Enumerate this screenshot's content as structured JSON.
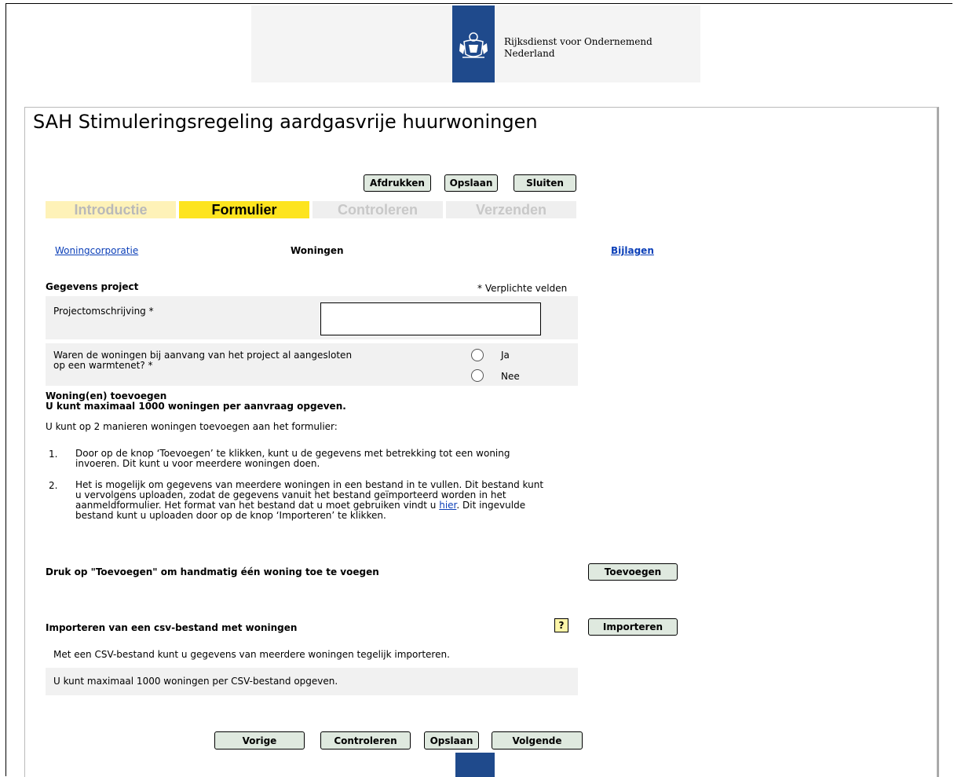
{
  "header": {
    "org_line1": "Rijksdienst voor Ondernemend",
    "org_line2": "Nederland"
  },
  "page_title": "SAH Stimuleringsregeling aardgasvrije huurwoningen",
  "top_buttons": {
    "print": "Afdrukken",
    "save": "Opslaan",
    "close": "Sluiten"
  },
  "steps": {
    "intro": "Introductie",
    "form": "Formulier",
    "check": "Controleren",
    "send": "Verzenden"
  },
  "subnav": {
    "corporation": "Woningcorporatie",
    "homes": "Woningen",
    "attachments": "Bijlagen"
  },
  "project": {
    "heading": "Gegevens project",
    "required_note": "* Verplichte velden",
    "description_label": "Projectomschrijving *",
    "description_value": "",
    "heat_q_line1": "Waren de woningen bij aanvang van het project al aangesloten",
    "heat_q_line2": "op een warmtenet? *",
    "opt_yes": "Ja",
    "opt_no": "Nee"
  },
  "add": {
    "heading": "Woning(en) toevoegen",
    "max_note": "U kunt maximaal 1000 woningen per aanvraag opgeven.",
    "intro": "U kunt op 2 manieren woningen toevoegen aan het formulier:",
    "item1_num": "1.",
    "item1_l1": "Door op de knop ‘Toevoegen’ te klikken, kunt u de gegevens met betrekking tot een woning",
    "item1_l2": "invoeren. Dit kunt u voor meerdere woningen doen.",
    "item2_num": "2.",
    "item2_l1": "Het is mogelijk om gegevens van meerdere woningen in een bestand in te vullen. Dit bestand kunt",
    "item2_l2": "u vervolgens uploaden, zodat de gegevens vanuit het bestand geïmporteerd worden in het",
    "item2_l3": "aanmeldformulier. Het format van het bestand dat u moet gebruiken vindt u",
    "item2_link": "hier",
    "item2_l3_end": ". Dit ingevulde",
    "item2_l4": "bestand kunt u uploaden door op de knop ‘Importeren’ te klikken."
  },
  "manual": {
    "label": "Druk op \"Toevoegen\" om handmatig één woning toe te voegen",
    "button": "Toevoegen"
  },
  "import": {
    "label": "Importeren van een csv-bestand met woningen",
    "help": "?",
    "button": "Importeren",
    "info1": "Met een CSV-bestand kunt u gegevens van meerdere woningen tegelijk importeren.",
    "info2": "U kunt maximaal 1000 woningen per CSV-bestand opgeven."
  },
  "bottom_buttons": {
    "prev": "Vorige",
    "check": "Controleren",
    "save": "Opslaan",
    "next": "Volgende"
  },
  "colors": {
    "brand_blue": "#1f4a8c",
    "active_step": "#fde41f",
    "button_bg": "#dfe9df",
    "link": "#0b3fb8"
  }
}
